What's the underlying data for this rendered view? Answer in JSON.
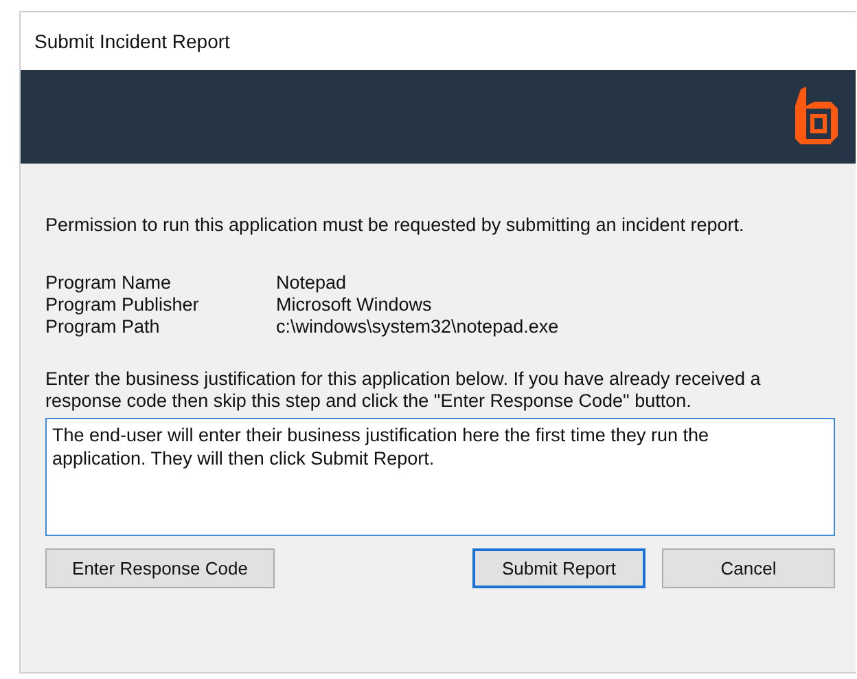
{
  "window": {
    "title": "Submit Incident Report"
  },
  "intro": "Permission to run this application must be requested by submitting an incident report.",
  "program_info": [
    {
      "label": "Program Name",
      "value": "Notepad"
    },
    {
      "label": "Program Publisher",
      "value": "Microsoft Windows"
    },
    {
      "label": "Program Path",
      "value": "c:\\windows\\system32\\notepad.exe"
    }
  ],
  "instructions": "Enter the business justification for this application below. If you have already received a response code then skip this step and click the \"Enter Response Code\" button.",
  "justification": {
    "value": "The end-user will enter their business justification here the first time they run the application. They will then click Submit Report."
  },
  "left_buttons": [
    {
      "label": "Enter Response Code",
      "focused": false
    }
  ],
  "right_buttons": [
    {
      "label": "Submit Report",
      "focused": true
    },
    {
      "label": "Cancel",
      "focused": false
    }
  ]
}
